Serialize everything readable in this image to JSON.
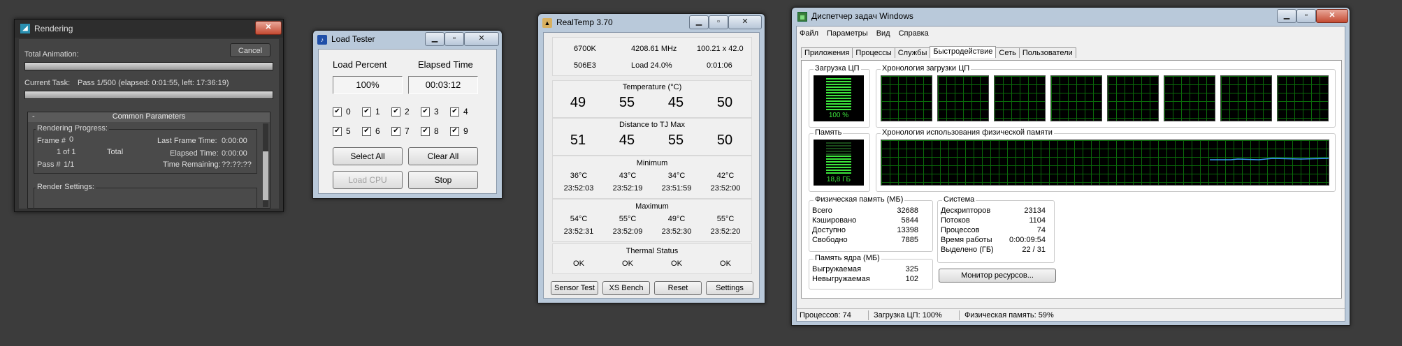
{
  "rendering": {
    "title": "Rendering",
    "cancel": "Cancel",
    "total_animation_label": "Total Animation:",
    "current_task_label": "Current Task:",
    "current_task_value": "Pass 1/500 (elapsed: 0:01:55, left: 17:36:19)",
    "common_params": "Common Parameters",
    "rendering_progress": "Rendering Progress:",
    "frame_label": "Frame #",
    "frame_value": "0",
    "of_value": "1 of 1",
    "total": "Total",
    "pass_label": "Pass #",
    "pass_value": "1/1",
    "last_frame_label": "Last Frame Time:",
    "last_frame_value": "0:00:00",
    "elapsed_label": "Elapsed Time:",
    "elapsed_value": "0:00:00",
    "remaining_label": "Time Remaining:",
    "remaining_value": "??:??:??",
    "render_settings": "Render Settings:",
    "collapse": "-"
  },
  "load_tester": {
    "title": "Load Tester",
    "load_percent_label": "Load Percent",
    "elapsed_label": "Elapsed Time",
    "load_percent_value": "100%",
    "elapsed_value": "00:03:12",
    "checkboxes": [
      "0",
      "1",
      "2",
      "3",
      "4",
      "5",
      "6",
      "7",
      "8",
      "9"
    ],
    "select_all": "Select All",
    "clear_all": "Clear All",
    "load_cpu": "Load CPU",
    "stop": "Stop"
  },
  "realtemp": {
    "title": "RealTemp 3.70",
    "cpu": "6700K",
    "freq": "4208.61 MHz",
    "mult": "100.21 x 42.0",
    "stepping": "506E3",
    "load": "Load  24.0%",
    "time": "0:01:06",
    "temperature_label": "Temperature (°C)",
    "temperature": [
      "49",
      "55",
      "45",
      "50"
    ],
    "distance_label": "Distance to TJ Max",
    "distance": [
      "51",
      "45",
      "55",
      "50"
    ],
    "minimum_label": "Minimum",
    "min_temps": [
      "36°C",
      "43°C",
      "34°C",
      "42°C"
    ],
    "min_times": [
      "23:52:03",
      "23:52:19",
      "23:51:59",
      "23:52:00"
    ],
    "maximum_label": "Maximum",
    "max_temps": [
      "54°C",
      "55°C",
      "49°C",
      "55°C"
    ],
    "max_times": [
      "23:52:31",
      "23:52:09",
      "23:52:30",
      "23:52:20"
    ],
    "thermal_label": "Thermal Status",
    "thermal": [
      "OK",
      "OK",
      "OK",
      "OK"
    ],
    "buttons": [
      "Sensor Test",
      "XS Bench",
      "Reset",
      "Settings"
    ]
  },
  "taskmgr": {
    "title": "Диспетчер задач Windows",
    "menu": [
      "Файл",
      "Параметры",
      "Вид",
      "Справка"
    ],
    "tabs": [
      "Приложения",
      "Процессы",
      "Службы",
      "Быстродействие",
      "Сеть",
      "Пользователи"
    ],
    "cpu_usage_label": "Загрузка ЦП",
    "cpu_usage_value": "100 %",
    "cpu_history_label": "Хронология загрузки ЦП",
    "memory_label": "Память",
    "memory_value": "18,8 ГБ",
    "memory_history_label": "Хронология использования физической памяти",
    "phys_label": "Физическая память (МБ)",
    "phys": [
      [
        "Всего",
        "32688"
      ],
      [
        "Кэшировано",
        "5844"
      ],
      [
        "Доступно",
        "13398"
      ],
      [
        "Свободно",
        "7885"
      ]
    ],
    "kernel_label": "Память ядра (МБ)",
    "kernel": [
      [
        "Выгружаемая",
        "325"
      ],
      [
        "Невыгружаемая",
        "102"
      ]
    ],
    "system_label": "Система",
    "system": [
      [
        "Дескрипторов",
        "23134"
      ],
      [
        "Потоков",
        "1104"
      ],
      [
        "Процессов",
        "74"
      ],
      [
        "Время работы",
        "0:00:09:54"
      ],
      [
        "Выделено (ГБ)",
        "22 / 31"
      ]
    ],
    "resource_monitor": "Монитор ресурсов...",
    "status_processes": "Процессов: 74",
    "status_cpu": "Загрузка ЦП: 100%",
    "status_memory": "Физическая память: 59%",
    "cpu_percent": 100,
    "memory_percent": 59
  }
}
